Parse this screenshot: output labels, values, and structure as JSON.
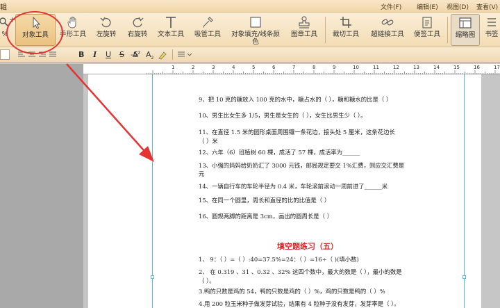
{
  "menubar": {
    "doc_tab": "辑",
    "menus": [
      {
        "label": "文件(F)"
      },
      {
        "label": "编辑(E)"
      },
      {
        "label": "视图(D)"
      },
      {
        "label": "查看(V)"
      }
    ]
  },
  "toolbar": {
    "zoom_text": "%",
    "tools": [
      {
        "label": "对象工具",
        "icon": "pointer-arrow-icon"
      },
      {
        "label": "手形工具",
        "icon": "hand-icon"
      },
      {
        "label": "左旋转",
        "icon": "rotate-left-icon"
      },
      {
        "label": "右旋转",
        "icon": "rotate-right-icon"
      },
      {
        "label": "文本工具",
        "icon": "text-t-icon"
      },
      {
        "label": "吸管工具",
        "icon": "eyedropper-icon"
      },
      {
        "label": "对象填充/线条颜色",
        "icon": "fill-square-icon"
      },
      {
        "label": "图章工具",
        "icon": "stamp-icon"
      },
      {
        "label": "裁切工具",
        "icon": "crop-icon"
      },
      {
        "label": "超链接工具",
        "icon": "link-icon"
      },
      {
        "label": "便签工具",
        "icon": "note-icon"
      },
      {
        "label": "缩略图",
        "icon": "thumbnail-icon"
      },
      {
        "label": "书签",
        "icon": "bookmark-icon"
      }
    ]
  },
  "format": {
    "bold": "B",
    "italic": "I",
    "underline": "U",
    "strike": "S",
    "strike2": "-S",
    "superscript": "A",
    "subscript": "A"
  },
  "ruler": {
    "marks": [
      "1",
      "2",
      "3",
      "4",
      "5",
      "6",
      "7",
      "8",
      "9",
      "10",
      "11",
      "12",
      "13",
      "14",
      "15",
      "16",
      "17",
      "18"
    ]
  },
  "document": {
    "lines": [
      "9、把 10 克的糖放入 100 克的水中，糖占水的（    ），糖和糖水的比是（      ）",
      "10、男生比女生多 1/5，男生是女生的（       ），女生比男生少（          ）。",
      "11、在直径 1.5 米的圆形桌面周围镶一条花边，接头处 5 厘米，这条花边长",
      "（     ）米",
      "12、六年（6）班植树 60 棵，成活了 57 棵，成活率为______",
      "13、小强的妈妈给奶奶汇了 3000 元钱，邮局规定要交 1%汇费，则应交汇费是",
      "元",
      "14、一辆自行车的车轮半径为 0.4 米，车轮滚前滚动一周前进了______米",
      "15、在同一个圆里，周长和直径的比的比值是（                ）",
      "16、圆规两脚的距离是 3cm，画出的圆周长是（           ）"
    ],
    "section_title": "填空题练习（五）",
    "lines2": [
      "1、 9：（    ）=（   ）:40=37.5%=24：（    ）=16÷（    )(填小数)",
      "2、 在 0.319 、31 、0.32 、32% 这四个数中，最大的数是（      ），最小的数是",
      "（      ）。",
      "3.鸭的只数是鸡的 54，鸭的只数是鸡的（      ）%，鸡的只数是鸭的（      ）%",
      "4.用 200 粒玉米种子做发芽试验，结果有 4 粒种子没有发芽，发芽率是（        ）。"
    ]
  },
  "colors": {
    "annotation": "#e53232",
    "title_red": "#d42a2a",
    "guide": "#5fb7d8"
  }
}
